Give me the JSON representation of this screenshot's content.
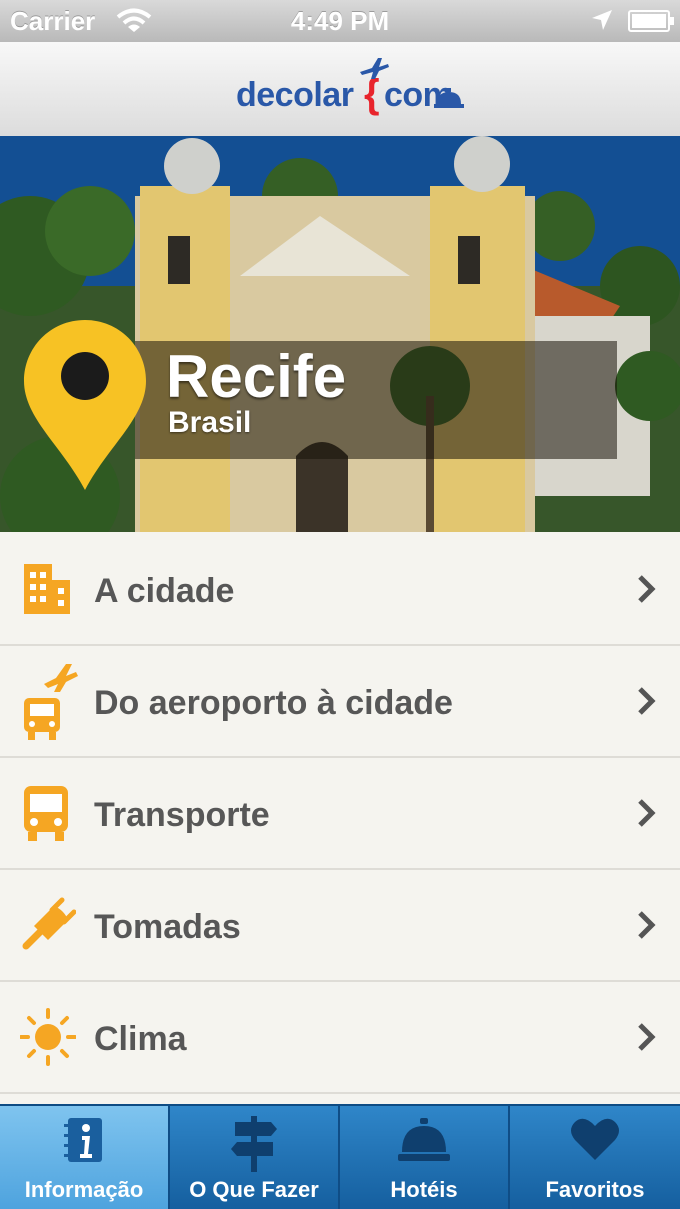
{
  "status_bar": {
    "carrier": "Carrier",
    "time": "4:49 PM"
  },
  "header": {
    "logo_left": "decolar",
    "logo_right": "com",
    "logo_bracket": "{"
  },
  "hero": {
    "city": "Recife",
    "country": "Brasil"
  },
  "menu": {
    "items": [
      {
        "label": "A cidade",
        "icon": "building-icon"
      },
      {
        "label": "Do aeroporto à cidade",
        "icon": "airport-bus-icon"
      },
      {
        "label": "Transporte",
        "icon": "bus-icon"
      },
      {
        "label": "Tomadas",
        "icon": "plug-icon"
      },
      {
        "label": "Clima",
        "icon": "sun-icon"
      }
    ]
  },
  "tabs": [
    {
      "label": "Informação",
      "icon": "info-book-icon",
      "active": true
    },
    {
      "label": "O Que Fazer",
      "icon": "signpost-icon",
      "active": false
    },
    {
      "label": "Hotéis",
      "icon": "service-bell-icon",
      "active": false
    },
    {
      "label": "Favoritos",
      "icon": "heart-icon",
      "active": false
    }
  ],
  "colors": {
    "accent_orange": "#f5a623",
    "tab_blue": "#1f6fb2",
    "text_gray": "#575757"
  }
}
